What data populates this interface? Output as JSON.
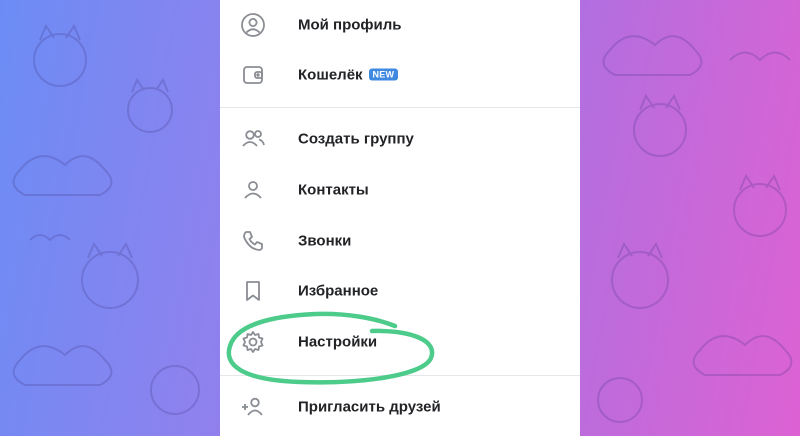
{
  "menu": {
    "items": [
      {
        "label": "Мой профиль",
        "icon": "profile-icon"
      },
      {
        "label": "Кошелёк",
        "icon": "wallet-icon",
        "badge": "NEW"
      },
      {
        "label": "Создать группу",
        "icon": "group-icon"
      },
      {
        "label": "Контакты",
        "icon": "contact-icon"
      },
      {
        "label": "Звонки",
        "icon": "phone-icon"
      },
      {
        "label": "Избранное",
        "icon": "bookmark-icon"
      },
      {
        "label": "Настройки",
        "icon": "gear-icon"
      },
      {
        "label": "Пригласить друзей",
        "icon": "add-user-icon"
      }
    ]
  },
  "colors": {
    "badge": "#3f8ae0",
    "highlight_stroke": "#4ccb8a",
    "icon_stroke": "#8a8d93",
    "background_left": "#6c8cf5",
    "background_right": "#dd62d3"
  }
}
